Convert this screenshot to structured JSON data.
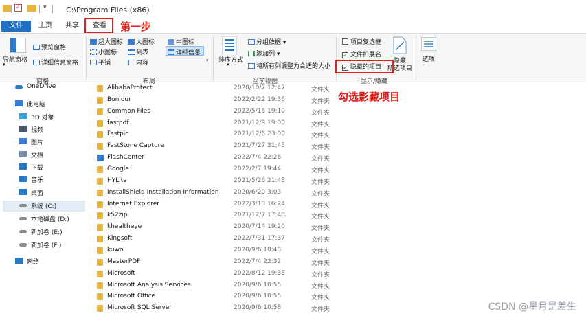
{
  "window": {
    "path": "C:\\Program Files (x86)"
  },
  "tabs": {
    "file": "文件",
    "home": "主页",
    "share": "共享",
    "view": "查看"
  },
  "annotations": {
    "step1": "第一步",
    "check_hidden": "勾选影藏项目"
  },
  "ribbon": {
    "panes": {
      "nav_pane": "导航窗格",
      "preview": "预览窗格",
      "details": "详细信息窗格",
      "group_label": "窗格"
    },
    "layout": {
      "extra_large": "超大图标",
      "large": "大图标",
      "medium": "中图标",
      "small": "小图标",
      "list": "列表",
      "details": "详细信息",
      "tiles": "平铺",
      "content": "内容",
      "group_label": "布局"
    },
    "current_view": {
      "sort": "排序方式",
      "group_by": "分组依据",
      "add_column": "添加列",
      "fit_columns": "将所有列调整为合适的大小",
      "group_label": "当前视图"
    },
    "show_hide": {
      "item_checkboxes": "项目复选框",
      "file_ext": "文件扩展名",
      "hidden_items": "隐藏的项目",
      "hide_selected_1": "隐藏",
      "hide_selected_2": "所选项目",
      "group_label": "显示/隐藏",
      "checks": {
        "item_checkboxes": false,
        "file_ext": true,
        "hidden_items": true
      }
    },
    "options": "选项"
  },
  "nav": [
    {
      "label": "OneDrive",
      "icon": "cloud-icon"
    },
    {
      "label": "此电脑",
      "icon": "computer-icon"
    },
    {
      "label": "3D 对象",
      "icon": "cube-icon"
    },
    {
      "label": "视频",
      "icon": "video-icon"
    },
    {
      "label": "图片",
      "icon": "picture-icon"
    },
    {
      "label": "文档",
      "icon": "document-icon"
    },
    {
      "label": "下载",
      "icon": "download-icon"
    },
    {
      "label": "音乐",
      "icon": "music-icon"
    },
    {
      "label": "桌面",
      "icon": "desktop-icon"
    },
    {
      "label": "系统 (C:)",
      "icon": "drive-icon"
    },
    {
      "label": "本地磁盘 (D:)",
      "icon": "drive-icon"
    },
    {
      "label": "新加卷 (E:)",
      "icon": "drive-icon"
    },
    {
      "label": "新加卷 (F:)",
      "icon": "drive-icon"
    },
    {
      "label": "网络",
      "icon": "network-icon"
    }
  ],
  "files": [
    {
      "name": "AlibabaProtect",
      "date": "2020/10/7 12:47",
      "type": "文件夹"
    },
    {
      "name": "Bonjour",
      "date": "2022/2/22 19:36",
      "type": "文件夹"
    },
    {
      "name": "Common Files",
      "date": "2022/5/16 19:10",
      "type": "文件夹"
    },
    {
      "name": "fastpdf",
      "date": "2021/12/9 19:00",
      "type": "文件夹"
    },
    {
      "name": "Fastpic",
      "date": "2021/12/6 23:00",
      "type": "文件夹"
    },
    {
      "name": "FastStone Capture",
      "date": "2021/7/27 21:45",
      "type": "文件夹"
    },
    {
      "name": "FlashCenter",
      "date": "2022/7/4 22:26",
      "type": "文件夹"
    },
    {
      "name": "Google",
      "date": "2022/2/7 19:44",
      "type": "文件夹"
    },
    {
      "name": "HYLite",
      "date": "2021/5/26 21:43",
      "type": "文件夹"
    },
    {
      "name": "InstallShield Installation Information",
      "date": "2020/6/20 3:03",
      "type": "文件夹"
    },
    {
      "name": "Internet Explorer",
      "date": "2022/3/13 16:24",
      "type": "文件夹"
    },
    {
      "name": "k52zip",
      "date": "2021/12/7 17:48",
      "type": "文件夹"
    },
    {
      "name": "khealtheye",
      "date": "2020/7/14 19:20",
      "type": "文件夹"
    },
    {
      "name": "Kingsoft",
      "date": "2022/7/31 17:37",
      "type": "文件夹"
    },
    {
      "name": "kuwo",
      "date": "2020/9/6 10:43",
      "type": "文件夹"
    },
    {
      "name": "MasterPDF",
      "date": "2022/7/4 22:32",
      "type": "文件夹"
    },
    {
      "name": "Microsoft",
      "date": "2022/8/12 19:38",
      "type": "文件夹"
    },
    {
      "name": "Microsoft Analysis Services",
      "date": "2020/9/6 10:55",
      "type": "文件夹"
    },
    {
      "name": "Microsoft Office",
      "date": "2020/9/6 10:55",
      "type": "文件夹"
    },
    {
      "name": "Microsoft SQL Server",
      "date": "2020/9/6 10:58",
      "type": "文件夹"
    }
  ],
  "watermark": "CSDN @星月是差生"
}
